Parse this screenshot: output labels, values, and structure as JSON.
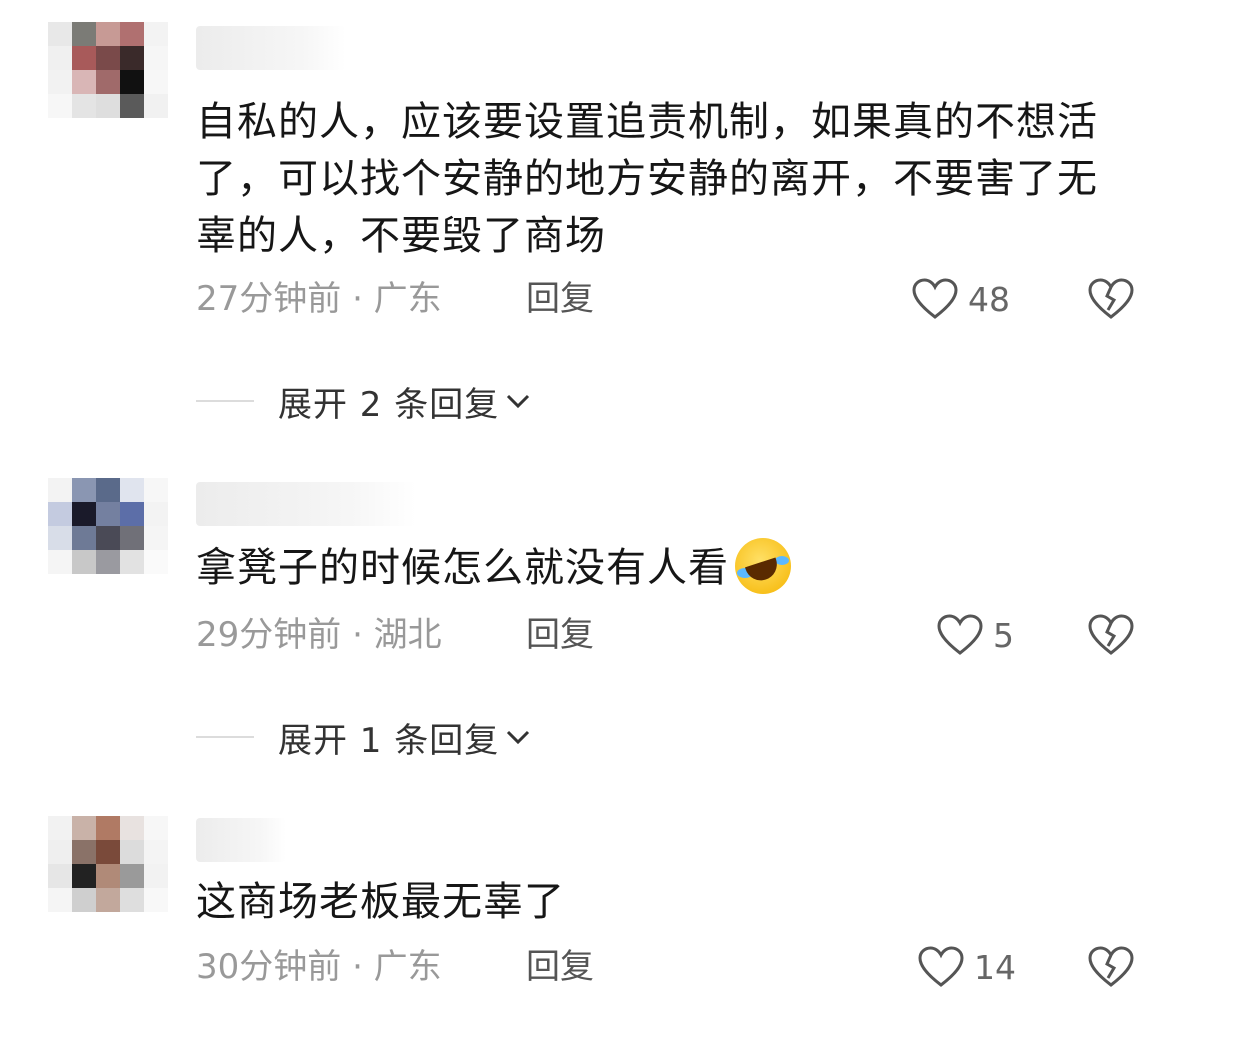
{
  "comments": [
    {
      "text": "自私的人，应该要设置追责机制，如果真的不想活了，可以找个安静的地方安静的离开，不要害了无辜的人，不要毁了商场",
      "time_location": "27分钟前 · 广东",
      "reply_label": "回复",
      "likes": "48",
      "expand_label": "展开 2 条回复"
    },
    {
      "text": "拿凳子的时候怎么就没有人看",
      "emoji": "laughing-crying-emoji",
      "time_location": "29分钟前 · 湖北",
      "reply_label": "回复",
      "likes": "5",
      "expand_label": "展开 1 条回复"
    },
    {
      "text": "这商场老板最无辜了",
      "time_location": "30分钟前 · 广东",
      "reply_label": "回复",
      "likes": "14"
    }
  ],
  "icons": {
    "like": "heart-icon",
    "dislike": "broken-heart-icon",
    "expand": "chevron-down-icon"
  },
  "colors": {
    "text_primary": "#161616",
    "text_meta": "#999999",
    "icon_gray": "#555555"
  }
}
